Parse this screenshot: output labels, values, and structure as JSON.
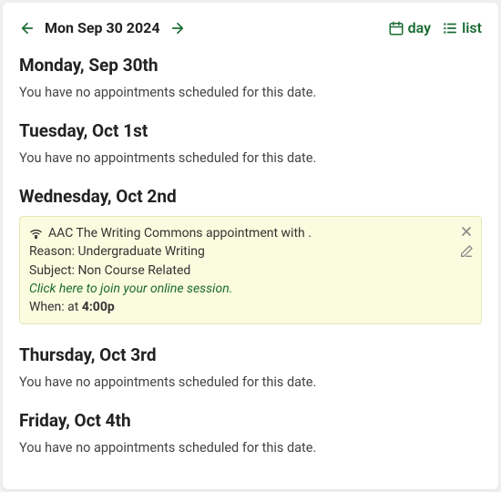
{
  "header": {
    "current_date_label": "Mon Sep 30 2024",
    "view_day_label": "day",
    "view_list_label": "list"
  },
  "days": [
    {
      "heading": "Monday, Sep 30th",
      "empty_msg": "You have no appointments scheduled for this date."
    },
    {
      "heading": "Tuesday, Oct 1st",
      "empty_msg": "You have no appointments scheduled for this date."
    },
    {
      "heading": "Wednesday, Oct 2nd"
    },
    {
      "heading": "Thursday, Oct 3rd",
      "empty_msg": "You have no appointments scheduled for this date."
    },
    {
      "heading": "Friday, Oct 4th",
      "empty_msg": "You have no appointments scheduled for this date."
    }
  ],
  "appointment": {
    "title": "AAC The Writing Commons appointment with .",
    "reason_label": "Reason: ",
    "reason_value": "Undergraduate Writing",
    "subject_label": "Subject: ",
    "subject_value": "Non Course Related",
    "join_link": "Click here to join your online session.",
    "when_label": "When: at ",
    "when_time": "4:00p"
  }
}
